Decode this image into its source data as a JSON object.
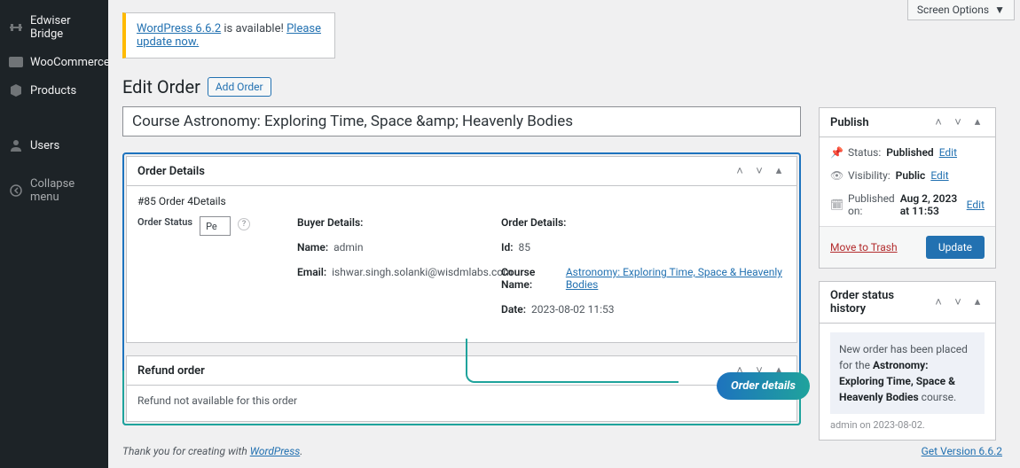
{
  "screen_options": "Screen Options",
  "sidebar": {
    "items": [
      {
        "label": "Edwiser Bridge",
        "icon": "bridge"
      },
      {
        "label": "WooCommerce",
        "icon": "woo"
      },
      {
        "label": "Products",
        "icon": "products"
      },
      {
        "label": "Users",
        "icon": "users"
      },
      {
        "label": "Collapse menu",
        "icon": "collapse"
      }
    ]
  },
  "notice": {
    "prefix": "WordPress 6.6.2",
    "middle": " is available! ",
    "link": "Please update now."
  },
  "page": {
    "title": "Edit Order",
    "add_button": "Add Order",
    "title_input": "Course Astronomy: Exploring Time, Space &amp; Heavenly Bodies"
  },
  "order_details": {
    "box_title": "Order Details",
    "subtitle": "#85 Order 4Details",
    "status_label": "Order Status",
    "status_value": "Pe",
    "buyer_heading": "Buyer Details:",
    "buyer_name_label": "Name:",
    "buyer_name": "admin",
    "buyer_email_label": "Email:",
    "buyer_email": "ishwar.singh.solanki@wisdmlabs.com",
    "order_heading": "Order Details:",
    "id_label": "Id:",
    "id": "85",
    "course_label": "Course Name:",
    "course_name": "Astronomy: Exploring Time, Space & Heavenly Bodies",
    "date_label": "Date:",
    "date": "2023-08-02 11:53"
  },
  "refund": {
    "box_title": "Refund order",
    "text": "Refund not available for this order"
  },
  "publish": {
    "box_title": "Publish",
    "status_label": "Status:",
    "status_value": "Published",
    "visibility_label": "Visibility:",
    "visibility_value": "Public",
    "published_label": "Published on:",
    "published_value": "Aug 2, 2023 at 11:53",
    "edit": "Edit",
    "trash": "Move to Trash",
    "update": "Update"
  },
  "history": {
    "box_title": "Order status history",
    "note_prefix": "New order has been placed for the ",
    "note_course": "Astronomy: Exploring Time, Space & Heavenly Bodies",
    "note_suffix": " course.",
    "meta": "admin on 2023-08-02."
  },
  "callout": "Order details",
  "footer": {
    "left_prefix": "Thank you for creating with ",
    "left_link": "WordPress",
    "left_suffix": ".",
    "right": "Get Version 6.6.2"
  }
}
